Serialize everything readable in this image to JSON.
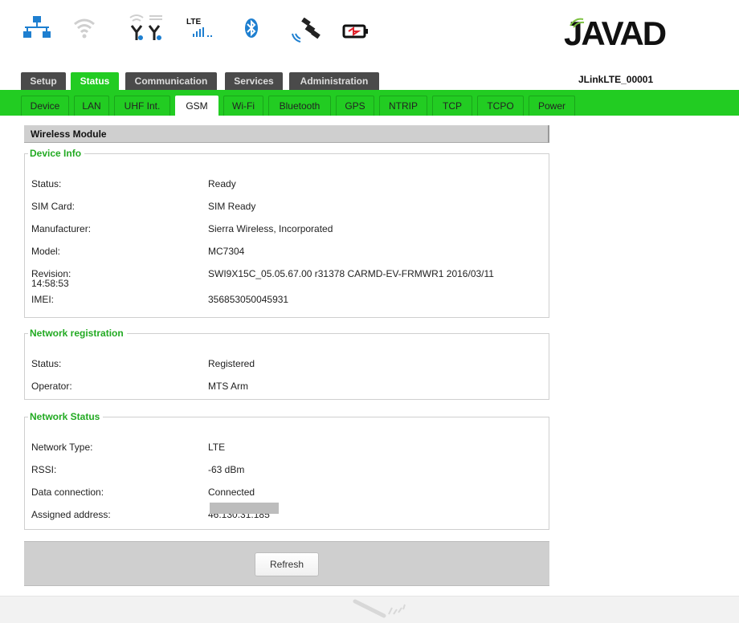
{
  "status_icons": {
    "ethernet": "ethernet-network-icon",
    "wifi": "wifi-icon",
    "antennas": "antenna-icon",
    "lte": "LTE",
    "bluetooth": "bluetooth-icon",
    "satellite": "satellite-icon",
    "battery": "battery-charging-icon"
  },
  "brand": {
    "name": "JAVAD"
  },
  "device_name": "JLinkLTE_00001",
  "main_tabs": [
    {
      "label": "Setup",
      "active": false
    },
    {
      "label": "Status",
      "active": true
    },
    {
      "label": "Communication",
      "active": false
    },
    {
      "label": "Services",
      "active": false
    },
    {
      "label": "Administration",
      "active": false
    }
  ],
  "sub_tabs": [
    {
      "label": "Device",
      "active": false
    },
    {
      "label": "LAN",
      "active": false
    },
    {
      "label": "UHF Int.",
      "active": false
    },
    {
      "label": "GSM",
      "active": true
    },
    {
      "label": "Wi-Fi",
      "active": false
    },
    {
      "label": "Bluetooth",
      "active": false
    },
    {
      "label": "GPS",
      "active": false
    },
    {
      "label": "NTRIP",
      "active": false
    },
    {
      "label": "TCP",
      "active": false
    },
    {
      "label": "TCPO",
      "active": false
    },
    {
      "label": "Power",
      "active": false
    }
  ],
  "section_title": "Wireless Module",
  "device_info": {
    "legend": "Device Info",
    "rows": [
      {
        "label": "Status:",
        "value": "Ready"
      },
      {
        "label": "SIM Card:",
        "value": "SIM Ready"
      },
      {
        "label": "Manufacturer:",
        "value": "Sierra Wireless, Incorporated"
      },
      {
        "label": "Model:",
        "value": "MC7304"
      },
      {
        "label": "Revision:",
        "label_extra": "14:58:53",
        "value": "SWI9X15C_05.05.67.00 r31378 CARMD-EV-FRMWR1 2016/03/11"
      },
      {
        "label": "IMEI:",
        "value": "356853050045931"
      }
    ]
  },
  "network_registration": {
    "legend": "Network registration",
    "rows": [
      {
        "label": "Status:",
        "value": "Registered"
      },
      {
        "label": "Operator:",
        "value": "MTS Arm"
      }
    ]
  },
  "network_status": {
    "legend": "Network Status",
    "rows": [
      {
        "label": "Network Type:",
        "value": "LTE"
      },
      {
        "label": "RSSI:",
        "value": "-63 dBm"
      },
      {
        "label": "Data connection:",
        "value": "Connected"
      },
      {
        "label": "Assigned address:",
        "value": "46.130.31.185"
      }
    ]
  },
  "refresh_label": "Refresh",
  "colors": {
    "accent": "#22cc22",
    "tab_dark": "#4a4a4a",
    "legend": "#22aa22",
    "panel": "#cfcfcf"
  }
}
